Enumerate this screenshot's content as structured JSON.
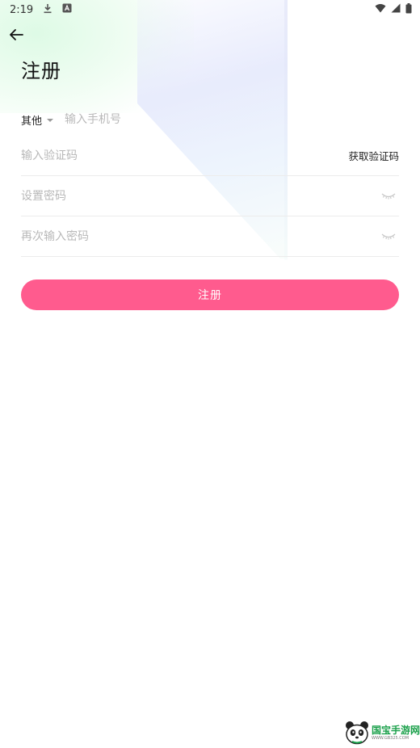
{
  "status_bar": {
    "time": "2:19",
    "icons": [
      "download-icon",
      "app-a-icon",
      "wifi-icon",
      "signal-icon",
      "battery-icon"
    ]
  },
  "header": {
    "title": "注册"
  },
  "form": {
    "country_label": "其他",
    "phone_placeholder": "输入手机号",
    "code_placeholder": "输入验证码",
    "get_code_label": "获取验证码",
    "password_placeholder": "设置密码",
    "confirm_password_placeholder": "再次输入密码"
  },
  "submit_label": "注册",
  "watermark": {
    "title": "国宝手游网",
    "url": "WWW.GB325.COM"
  },
  "colors": {
    "accent": "#ff5b8e",
    "placeholder": "#b8b8b8",
    "divider": "#ececec"
  }
}
